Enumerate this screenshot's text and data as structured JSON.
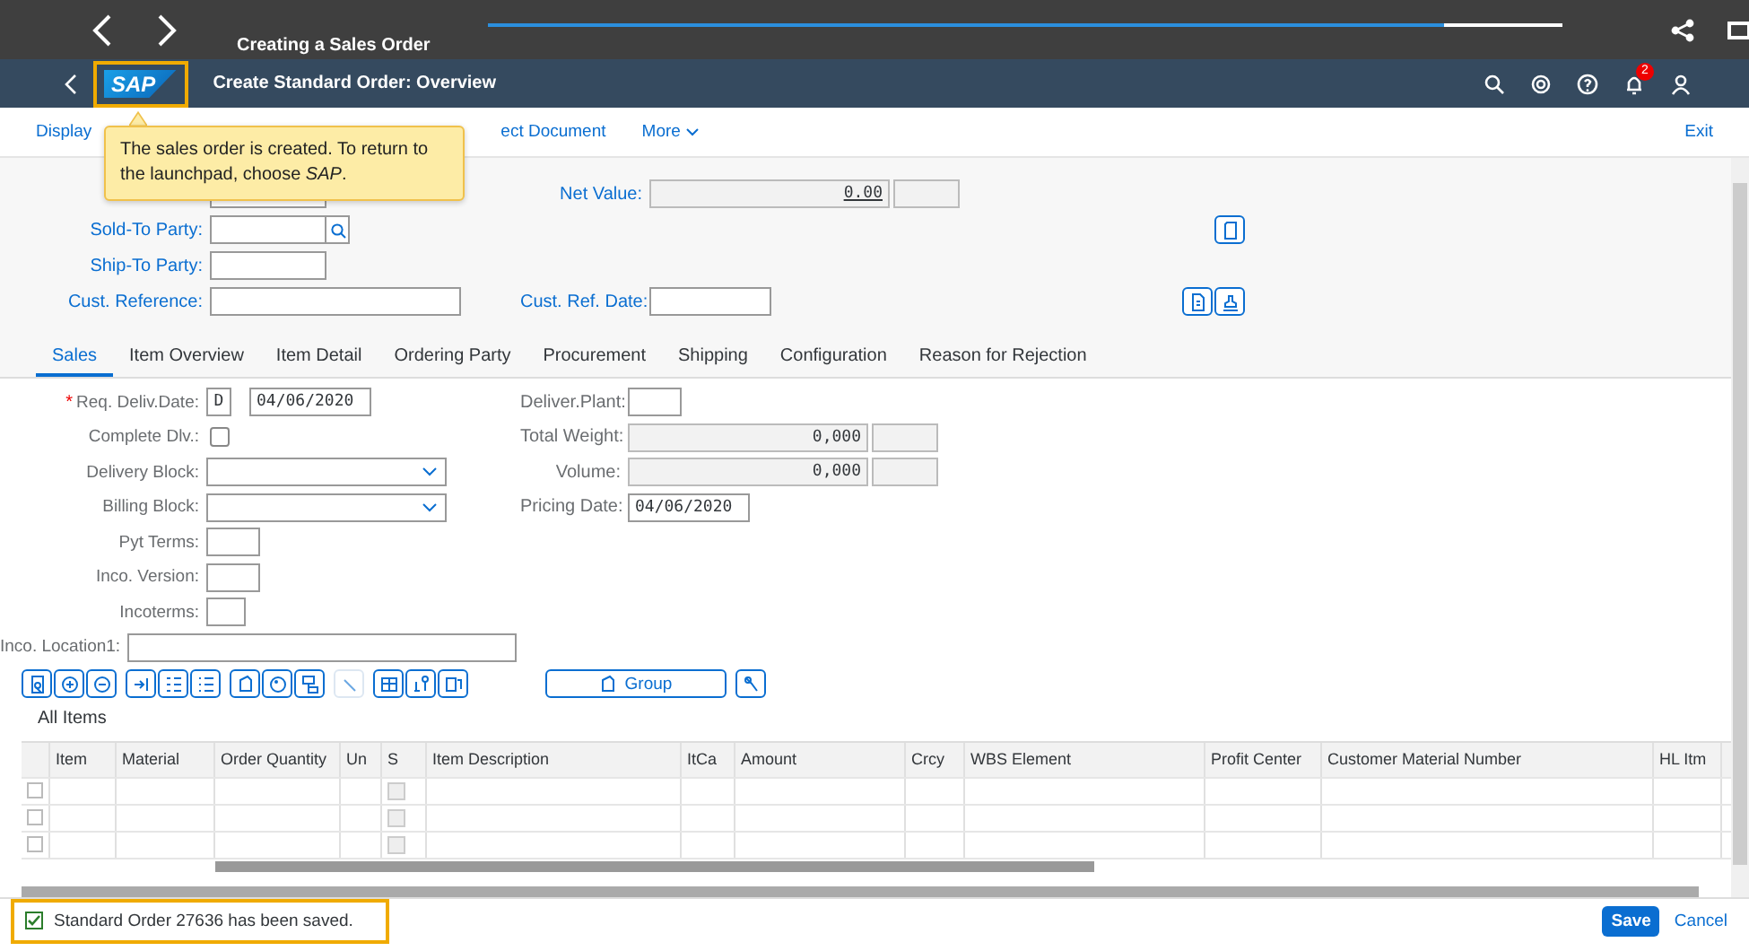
{
  "tutorial": {
    "title": "Creating a Sales Order",
    "level": 0.89
  },
  "shell": {
    "logo": "SAP",
    "title": "Create Standard Order: Overview",
    "notifications": "2"
  },
  "toolbar": {
    "items": [
      {
        "label": "Display",
        "kind": "link"
      },
      {
        "label": "ect Document",
        "kind": "link"
      },
      {
        "label": "More",
        "kind": "menu"
      }
    ],
    "exit": "Exit"
  },
  "tooltip": {
    "text": "The sales order is created. To return to the launchpad, choose *SAP*."
  },
  "header": {
    "rows": [
      {
        "left": {
          "kind": "field"
        },
        "right": {
          "label": "Net Value:",
          "kind": "amount",
          "value": "0.00"
        }
      },
      {
        "left": {
          "label": "Sold-To Party:",
          "kind": "search"
        },
        "right": {
          "kind": "doc-action"
        }
      },
      {
        "left": {
          "label": "Ship-To Party:",
          "kind": "field"
        }
      },
      {
        "left": {
          "label": "Cust. Reference:",
          "kind": "wide"
        },
        "right": {
          "label": "Cust. Ref. Date:",
          "kind": "field-actions"
        }
      }
    ]
  },
  "tabs": [
    {
      "label": "Sales",
      "selected": true
    },
    {
      "label": "Item Overview",
      "selected": false
    },
    {
      "label": "Item Detail",
      "selected": false
    },
    {
      "label": "Ordering Party",
      "selected": false
    },
    {
      "label": "Procurement",
      "selected": false
    },
    {
      "label": "Shipping",
      "selected": false
    },
    {
      "label": "Configuration",
      "selected": false
    },
    {
      "label": "Reason for Rejection",
      "selected": false
    }
  ],
  "sales": {
    "left": [
      {
        "label": "Req. Deliv.Date:",
        "kind": "date",
        "required_mark": "*",
        "prefix": "D",
        "value": "04/06/2020"
      },
      {
        "label": "Complete Dlv.:",
        "kind": "checkbox",
        "checked": false
      },
      {
        "label": "Delivery Block:",
        "kind": "dropdown"
      },
      {
        "label": "Billing Block:",
        "kind": "dropdown"
      },
      {
        "label": "Pyt Terms:",
        "kind": "short"
      },
      {
        "label": "Inco. Version:",
        "kind": "short"
      },
      {
        "label": "Incoterms:",
        "kind": "tiny"
      },
      {
        "label": "Inco. Location1:",
        "kind": "long"
      }
    ],
    "right": [
      {
        "label": "Deliver.Plant:",
        "kind": "tiny"
      },
      {
        "label": "Total Weight:",
        "kind": "amount",
        "value": "0,000"
      },
      {
        "label": "Volume:",
        "kind": "amount",
        "value": "0,000"
      },
      {
        "label": "Pricing Date:",
        "kind": "date",
        "value": "04/06/2020"
      }
    ]
  },
  "item_toolbar": {
    "group_button": "Group"
  },
  "items": {
    "title": "All Items",
    "columns": [
      "Item",
      "Material",
      "Order Quantity",
      "Un",
      "S",
      "Item Description",
      "ItCa",
      "Amount",
      "Crcy",
      "WBS Element",
      "Profit Center",
      "Customer Material Number",
      "HL Itm"
    ],
    "rows": [
      {
        "selected": false,
        "s_checked": false
      },
      {
        "selected": false,
        "s_checked": false
      },
      {
        "selected": false,
        "s_checked": false
      }
    ]
  },
  "footer": {
    "message": "Standard Order 27636 has been saved.",
    "buttons": [
      {
        "label": "Save",
        "kind": "primary"
      },
      {
        "label": "Cancel",
        "kind": "plain"
      }
    ]
  }
}
